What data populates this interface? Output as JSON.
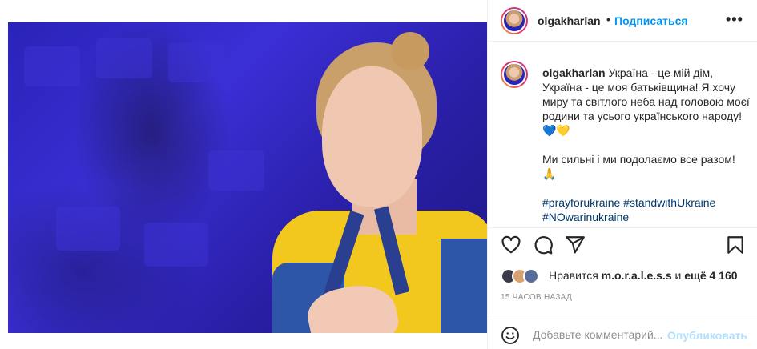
{
  "header": {
    "username": "olgakharlan",
    "separator": "•",
    "follow_label": "Подписаться",
    "more_label": "•••"
  },
  "caption": {
    "username": "olgakharlan",
    "paragraph1": "Україна - це мій дім, Україна - це моя батьківщина! Я хочу миру та світлого неба над головою моєї родини та усього українського народу! 💙💛",
    "paragraph2": "Ми сильні і ми подолаємо все разом! 🙏",
    "hashtags": "#prayforukraine #standwithUkraine #NOwarinukraine"
  },
  "actions": {
    "like_icon": "heart-icon",
    "comment_icon": "comment-icon",
    "share_icon": "send-icon",
    "save_icon": "bookmark-icon"
  },
  "likes": {
    "prefix": "Нравится",
    "liker": "m.o.r.a.l.e.s.s",
    "and": "и",
    "others": "ещё 4 160"
  },
  "timestamp": "15 часов назад",
  "comment": {
    "placeholder": "Добавьте комментарий...",
    "post_label": "Опубликовать"
  },
  "colors": {
    "accent": "#0095f6",
    "post_disabled": "#b2dffc",
    "hashtag": "#00376b",
    "muted": "#8e8e8e"
  }
}
